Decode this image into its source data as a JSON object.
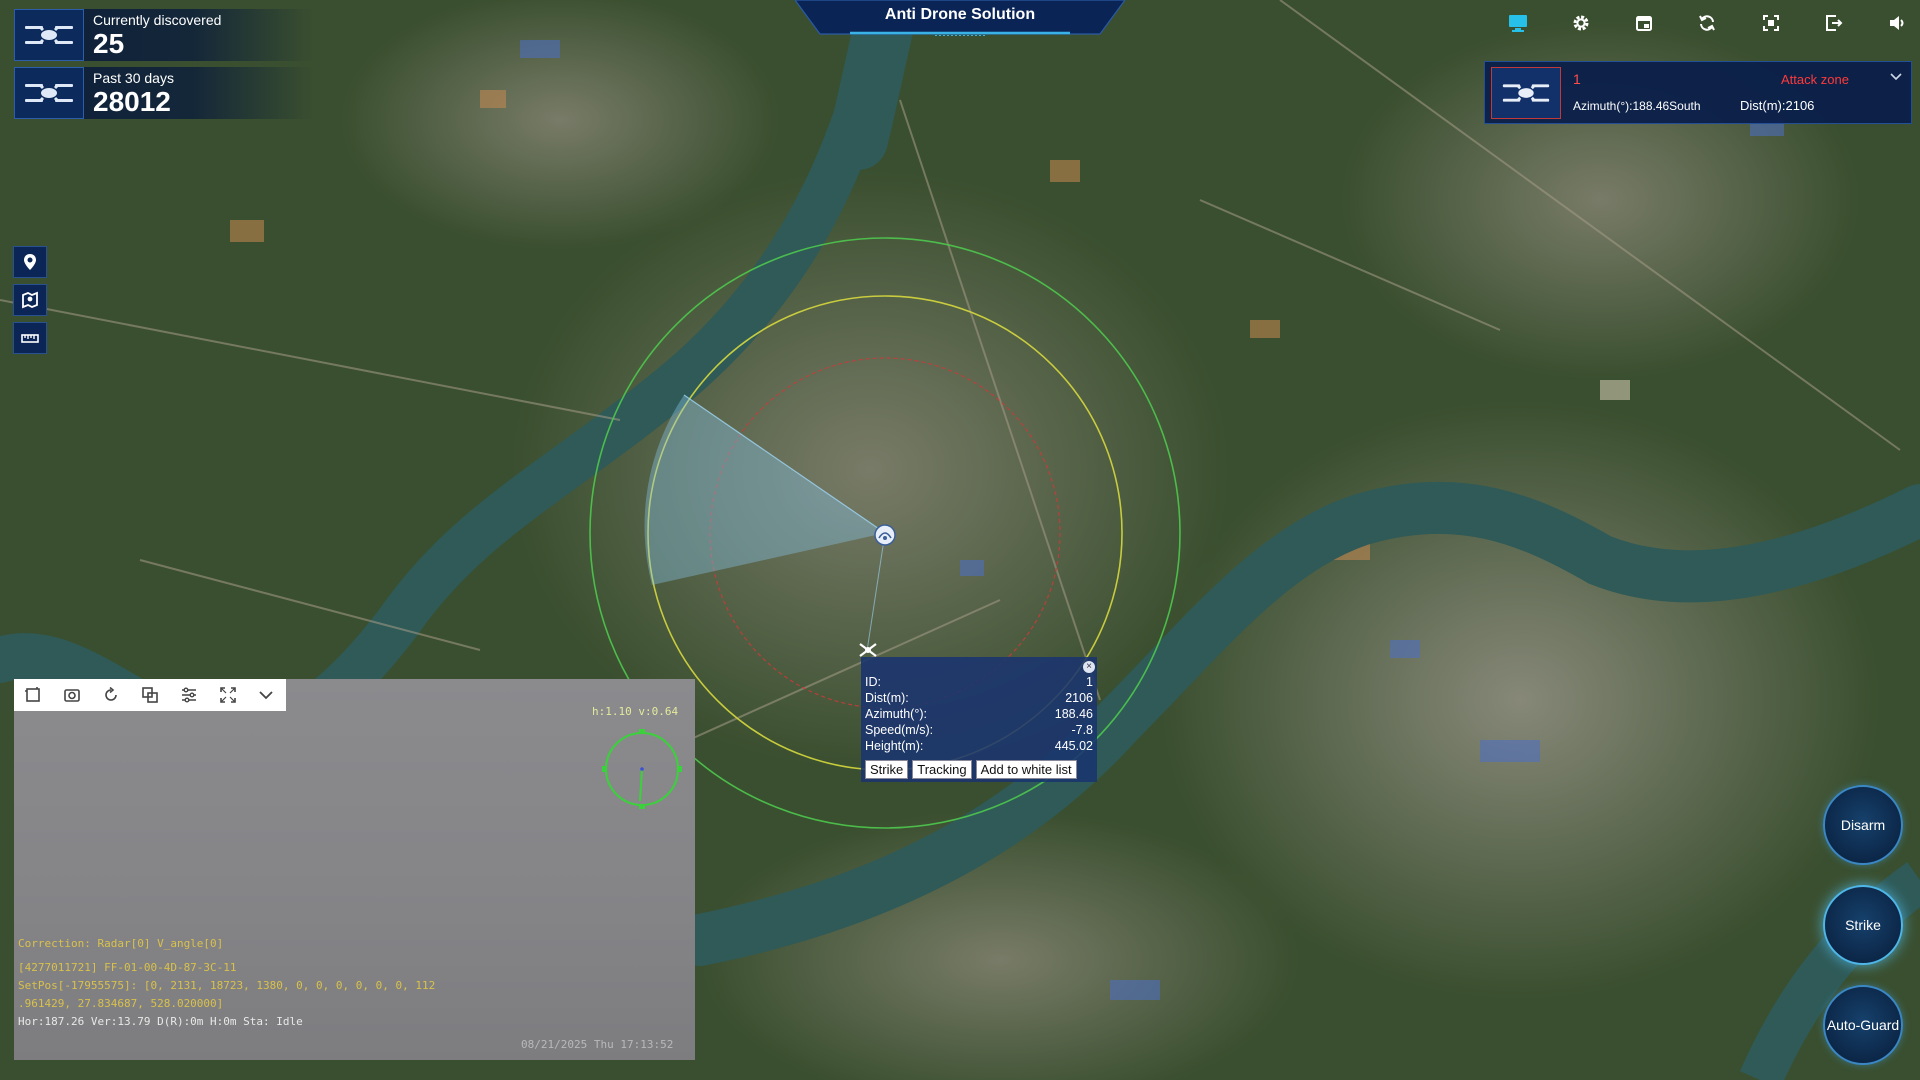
{
  "app": {
    "title": "Anti Drone Solution"
  },
  "stats": {
    "current": {
      "label": "Currently discovered",
      "value": "25",
      "icon": "drone-icon"
    },
    "past": {
      "label": "Past 30 days",
      "value": "28012",
      "icon": "drone-icon"
    }
  },
  "toolbar": {
    "items": [
      "monitor-icon",
      "gear-icon",
      "calendar-icon",
      "refresh-icon",
      "fullscreen-icon",
      "export-icon",
      "volume-icon"
    ]
  },
  "alert": {
    "id": "1",
    "zone": "Attack zone",
    "azimuth": "Azimuth(°):188.46South",
    "distance": "Dist(m):2106"
  },
  "map_tools": [
    "location-pin-icon",
    "map-layers-icon",
    "ruler-icon"
  ],
  "video": {
    "tools": [
      "crop-icon",
      "camera-icon",
      "rotate-icon",
      "pip-icon",
      "sliders-icon",
      "expand-icon",
      "chevron-down-icon"
    ],
    "zoom": "h:1.10 v:0.64",
    "overlay": {
      "line1": "Correction: Radar[0] V_angle[0]",
      "line2": "[4277011721] FF-01-00-4D-87-3C-11",
      "line3": "SetPos[-17955575]: [0, 2131, 18723, 1380, 0, 0, 0, 0, 0, 0, 112",
      "line4": ".961429, 27.834687, 528.020000]",
      "line5": "Hor:187.26 Ver:13.79 D(R):0m  H:0m  Sta: Idle",
      "timestamp": "08/21/2025 Thu 17:13:52"
    }
  },
  "popup": {
    "rows": [
      {
        "key": "ID:",
        "value": "1"
      },
      {
        "key": "Dist(m):",
        "value": "2106"
      },
      {
        "key": "Azimuth(°):",
        "value": "188.46"
      },
      {
        "key": "Speed(m/s):",
        "value": "-7.8"
      },
      {
        "key": "Height(m):",
        "value": "445.02"
      }
    ],
    "buttons": {
      "strike": "Strike",
      "tracking": "Tracking",
      "whitelist": "Add to white list"
    }
  },
  "actions": {
    "disarm": "Disarm",
    "strike": "Strike",
    "autoguard": "Auto-Guard"
  },
  "colors": {
    "panel": "#0a1e4a",
    "accent": "#2d5ea8",
    "alert_red": "#ff3a3a",
    "ring_outer": "#4ec84e",
    "ring_middle": "#d6d83e",
    "ring_inner": "#cc3a3a",
    "river": "#2f5a57"
  }
}
